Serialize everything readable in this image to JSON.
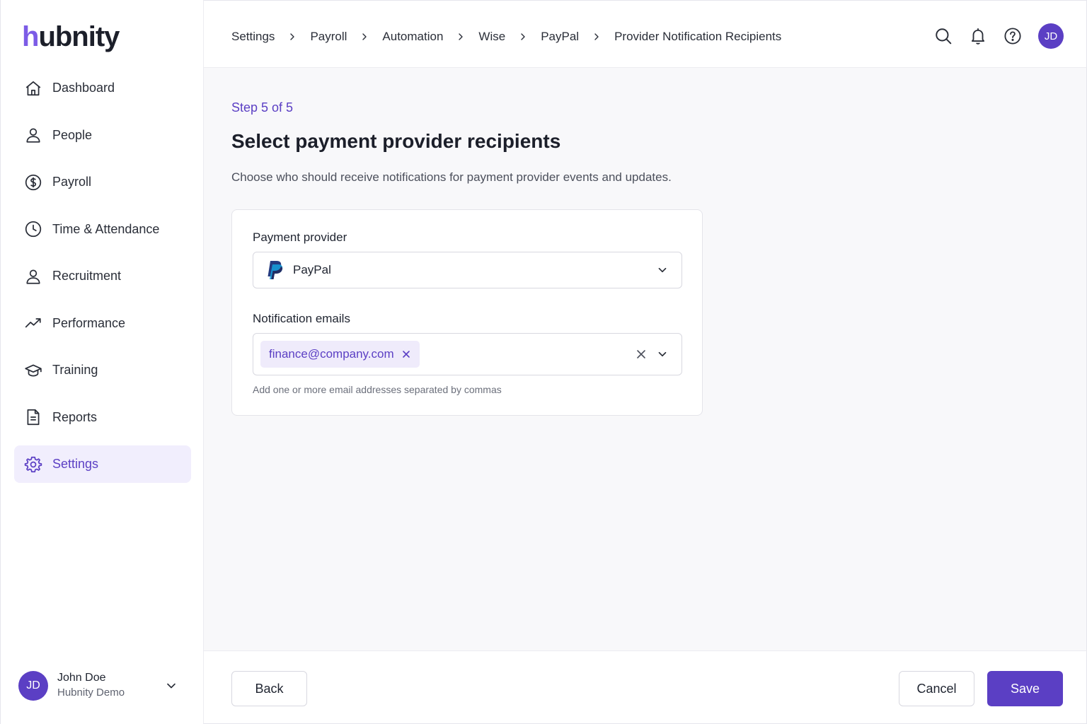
{
  "app": {
    "logo_first": "h",
    "logo_rest": "ubnity"
  },
  "sidebar": {
    "items": [
      {
        "label": "Dashboard",
        "icon": "home-icon"
      },
      {
        "label": "People",
        "icon": "person-icon"
      },
      {
        "label": "Payroll",
        "icon": "dollar-circle-icon"
      },
      {
        "label": "Time & Attendance",
        "icon": "clock-icon"
      },
      {
        "label": "Recruitment",
        "icon": "person-icon"
      },
      {
        "label": "Performance",
        "icon": "trend-up-icon"
      },
      {
        "label": "Training",
        "icon": "graduation-cap-icon"
      },
      {
        "label": "Reports",
        "icon": "document-icon"
      },
      {
        "label": "Settings",
        "icon": "gear-icon",
        "active": true
      }
    ]
  },
  "user": {
    "initials": "JD",
    "name": "John Doe",
    "org": "Hubnity Demo"
  },
  "breadcrumb": [
    "Settings",
    "Payroll",
    "Automation",
    "Wise",
    "PayPal",
    "Provider Notification Recipients"
  ],
  "topbar": {
    "avatar_initials": "JD",
    "icons": [
      "search-icon",
      "bell-icon",
      "help-icon"
    ]
  },
  "main": {
    "step": "Step 5 of 5",
    "title": "Select payment provider recipients",
    "description": "Choose who should receive notifications for payment provider events and updates."
  },
  "form": {
    "provider_label": "Payment provider",
    "provider_value": "PayPal",
    "emails_label": "Notification emails",
    "emails": [
      "finance@company.com"
    ],
    "emails_hint": "Add one or more email addresses separated by commas"
  },
  "footer": {
    "back": "Back",
    "cancel": "Cancel",
    "save": "Save"
  },
  "colors": {
    "accent": "#5b3fc4",
    "accent_light": "#f1eefd",
    "logo_accent": "#7c5ce6"
  }
}
